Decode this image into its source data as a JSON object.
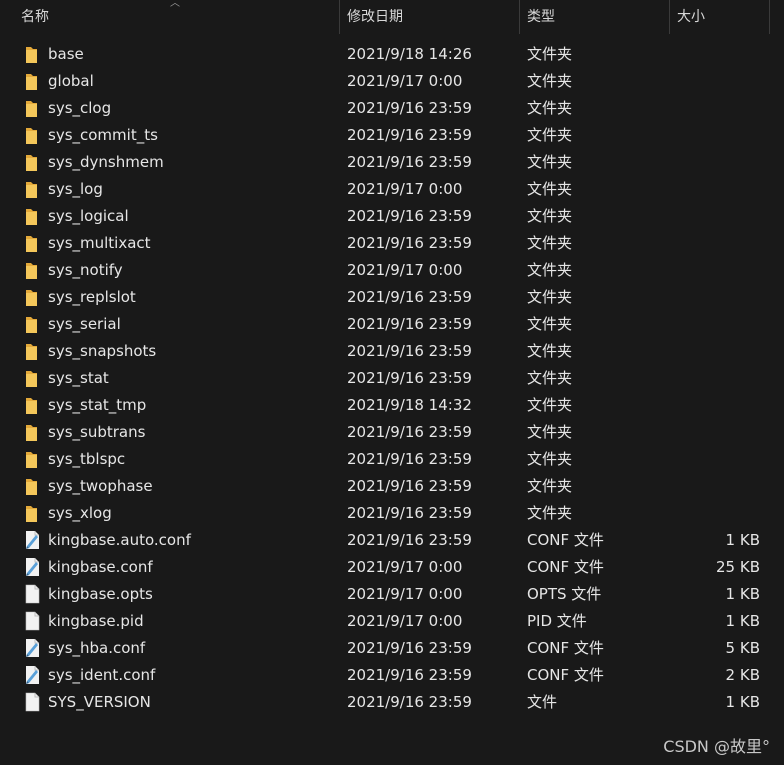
{
  "columns": {
    "name": "名称",
    "modified": "修改日期",
    "type": "类型",
    "size": "大小"
  },
  "icon_colors": {
    "folder": "#f4c75a",
    "folder_dark": "#e3a93a",
    "file": "#f2f2f2",
    "conf_blue": "#5aa0d8"
  },
  "files": [
    {
      "name": "base",
      "modified": "2021/9/18 14:26",
      "type": "文件夹",
      "size": "",
      "icon": "folder-icon"
    },
    {
      "name": "global",
      "modified": "2021/9/17 0:00",
      "type": "文件夹",
      "size": "",
      "icon": "folder-icon"
    },
    {
      "name": "sys_clog",
      "modified": "2021/9/16 23:59",
      "type": "文件夹",
      "size": "",
      "icon": "folder-icon"
    },
    {
      "name": "sys_commit_ts",
      "modified": "2021/9/16 23:59",
      "type": "文件夹",
      "size": "",
      "icon": "folder-icon"
    },
    {
      "name": "sys_dynshmem",
      "modified": "2021/9/16 23:59",
      "type": "文件夹",
      "size": "",
      "icon": "folder-icon"
    },
    {
      "name": "sys_log",
      "modified": "2021/9/17 0:00",
      "type": "文件夹",
      "size": "",
      "icon": "folder-icon"
    },
    {
      "name": "sys_logical",
      "modified": "2021/9/16 23:59",
      "type": "文件夹",
      "size": "",
      "icon": "folder-icon"
    },
    {
      "name": "sys_multixact",
      "modified": "2021/9/16 23:59",
      "type": "文件夹",
      "size": "",
      "icon": "folder-icon"
    },
    {
      "name": "sys_notify",
      "modified": "2021/9/17 0:00",
      "type": "文件夹",
      "size": "",
      "icon": "folder-icon"
    },
    {
      "name": "sys_replslot",
      "modified": "2021/9/16 23:59",
      "type": "文件夹",
      "size": "",
      "icon": "folder-icon"
    },
    {
      "name": "sys_serial",
      "modified": "2021/9/16 23:59",
      "type": "文件夹",
      "size": "",
      "icon": "folder-icon"
    },
    {
      "name": "sys_snapshots",
      "modified": "2021/9/16 23:59",
      "type": "文件夹",
      "size": "",
      "icon": "folder-icon"
    },
    {
      "name": "sys_stat",
      "modified": "2021/9/16 23:59",
      "type": "文件夹",
      "size": "",
      "icon": "folder-icon"
    },
    {
      "name": "sys_stat_tmp",
      "modified": "2021/9/18 14:32",
      "type": "文件夹",
      "size": "",
      "icon": "folder-icon"
    },
    {
      "name": "sys_subtrans",
      "modified": "2021/9/16 23:59",
      "type": "文件夹",
      "size": "",
      "icon": "folder-icon"
    },
    {
      "name": "sys_tblspc",
      "modified": "2021/9/16 23:59",
      "type": "文件夹",
      "size": "",
      "icon": "folder-icon"
    },
    {
      "name": "sys_twophase",
      "modified": "2021/9/16 23:59",
      "type": "文件夹",
      "size": "",
      "icon": "folder-icon"
    },
    {
      "name": "sys_xlog",
      "modified": "2021/9/16 23:59",
      "type": "文件夹",
      "size": "",
      "icon": "folder-icon"
    },
    {
      "name": "kingbase.auto.conf",
      "modified": "2021/9/16 23:59",
      "type": "CONF 文件",
      "size": "1 KB",
      "icon": "conf-file-icon"
    },
    {
      "name": "kingbase.conf",
      "modified": "2021/9/17 0:00",
      "type": "CONF 文件",
      "size": "25 KB",
      "icon": "conf-file-icon"
    },
    {
      "name": "kingbase.opts",
      "modified": "2021/9/17 0:00",
      "type": "OPTS 文件",
      "size": "1 KB",
      "icon": "file-icon"
    },
    {
      "name": "kingbase.pid",
      "modified": "2021/9/17 0:00",
      "type": "PID 文件",
      "size": "1 KB",
      "icon": "file-icon"
    },
    {
      "name": "sys_hba.conf",
      "modified": "2021/9/16 23:59",
      "type": "CONF 文件",
      "size": "5 KB",
      "icon": "conf-file-icon"
    },
    {
      "name": "sys_ident.conf",
      "modified": "2021/9/16 23:59",
      "type": "CONF 文件",
      "size": "2 KB",
      "icon": "conf-file-icon"
    },
    {
      "name": "SYS_VERSION",
      "modified": "2021/9/16 23:59",
      "type": "文件",
      "size": "1 KB",
      "icon": "file-icon"
    }
  ],
  "watermark": "CSDN @故里°"
}
